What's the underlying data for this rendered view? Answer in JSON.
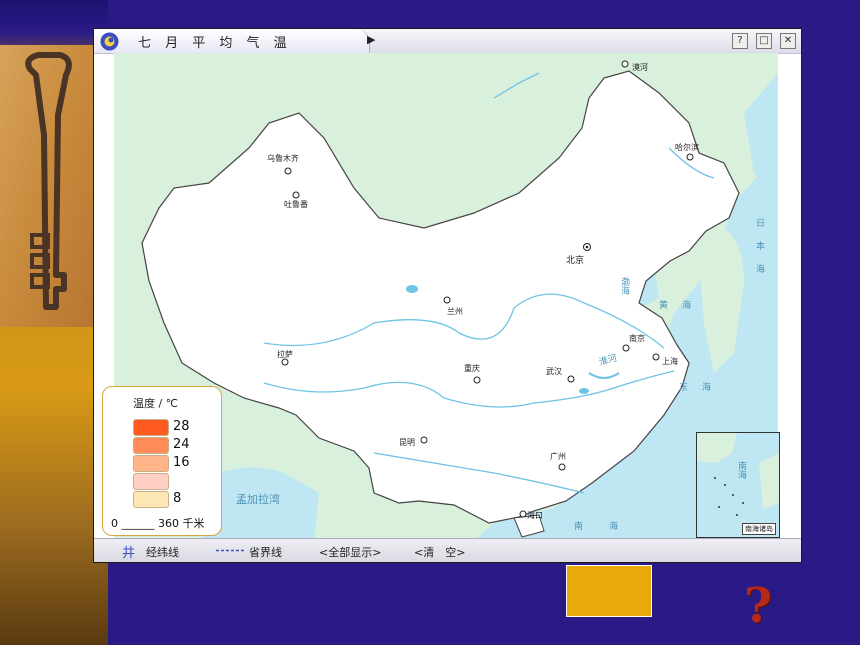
{
  "window": {
    "title": "七 月 平 均 气 温",
    "expand_arrow": "▶",
    "help_btn": "?",
    "restore_btn": "□",
    "close_btn": "✕"
  },
  "legend": {
    "title": "温度 / ℃",
    "items": [
      {
        "label": "28",
        "color": "#ff5a1f"
      },
      {
        "label": "24",
        "color": "#ff8a5a"
      },
      {
        "label": "16",
        "color": "#ffb48a"
      },
      {
        "label": "",
        "color": "#ffcfc4"
      },
      {
        "label": "8",
        "color": "#fde7b5"
      }
    ],
    "scale": "0 ______ 360 千米"
  },
  "cities": [
    {
      "name": "漠河",
      "icon": "city-dot"
    },
    {
      "name": "哈尔滨",
      "icon": "city-dot"
    },
    {
      "name": "乌鲁木齐",
      "icon": "city-dot"
    },
    {
      "name": "吐鲁番",
      "icon": "city-dot"
    },
    {
      "name": "北京",
      "icon": "capital-dot"
    },
    {
      "name": "兰州",
      "icon": "city-dot"
    },
    {
      "name": "拉萨",
      "icon": "city-dot"
    },
    {
      "name": "重庆",
      "icon": "city-dot"
    },
    {
      "name": "武汉",
      "icon": "city-dot"
    },
    {
      "name": "南京",
      "icon": "city-dot"
    },
    {
      "name": "上海",
      "icon": "city-dot"
    },
    {
      "name": "昆明",
      "icon": "city-dot"
    },
    {
      "name": "广州",
      "icon": "city-dot"
    },
    {
      "name": "海口",
      "icon": "city-dot"
    }
  ],
  "water_labels": {
    "bohai": "渤海",
    "huanghai": "黄海",
    "donghai": "东海",
    "nanhai": "南海",
    "riben_sea": "日本海",
    "huaihe": "淮河",
    "bengal": "孟加拉湾"
  },
  "inset": {
    "nanhai_label": "南海",
    "caption": "南海诸岛"
  },
  "toolbar": {
    "grid_icon": "井",
    "grid_label": "经纬线",
    "province_label": "省界线",
    "show_all_label": "<全部显示>",
    "clear_label": "<清　空>"
  },
  "colors": {
    "land": "#ffffff",
    "neighbor_land": "#d9f0dc",
    "sea": "#bfe6f3",
    "river": "#6fc3e6",
    "accent_box": "#e9a80b",
    "background": "#2a1a86"
  }
}
